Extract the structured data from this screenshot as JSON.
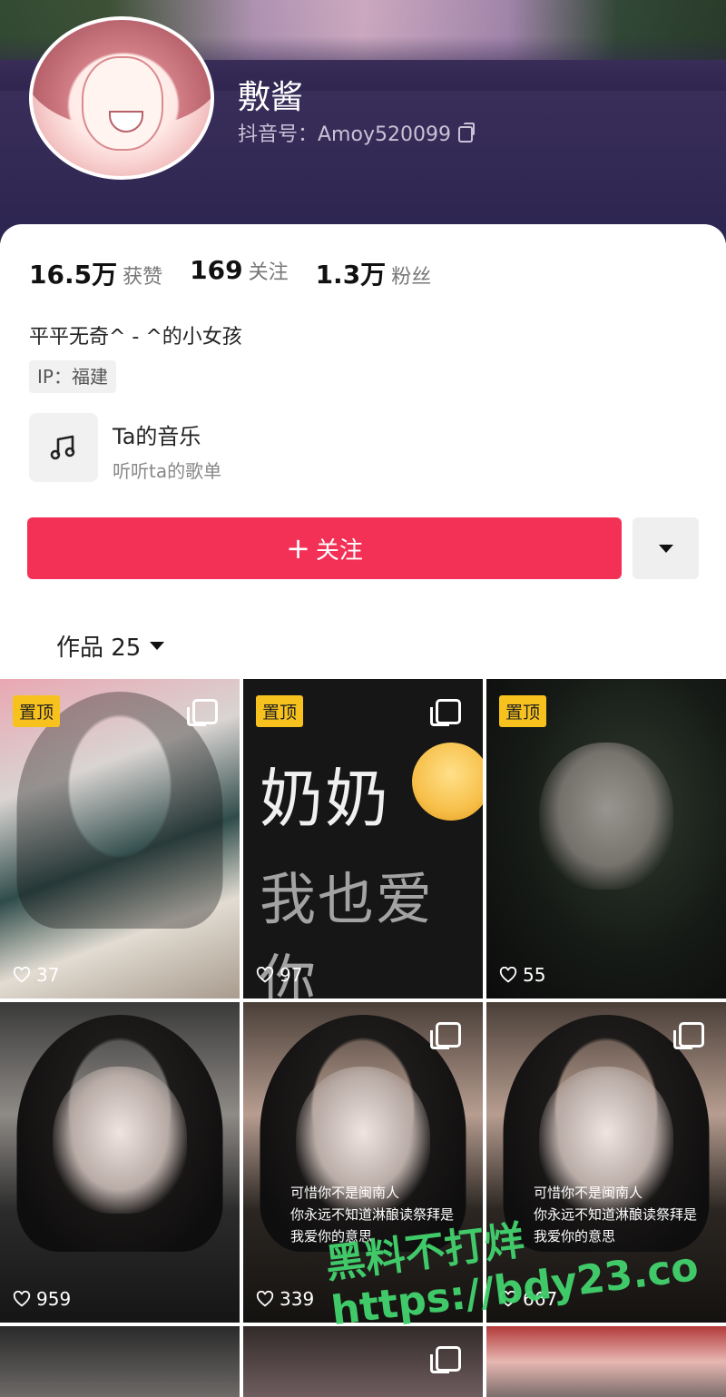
{
  "profile": {
    "name": "敷酱",
    "douyin_id": "抖音号：Amoy520099",
    "stats": [
      {
        "value": "16.5万",
        "label": "获赞"
      },
      {
        "value": "169",
        "label": "关注"
      },
      {
        "value": "1.3万",
        "label": "粉丝"
      }
    ],
    "bio": "平平无奇^ - ^的小女孩",
    "ip": "IP：福建",
    "music": {
      "title": "Ta的音乐",
      "subtitle": "听听ta的歌单"
    },
    "follow_label": "关注",
    "works_tab": "作品 25"
  },
  "videos": [
    {
      "pinned": "置顶",
      "likes": "37",
      "multi": true
    },
    {
      "pinned": "置顶",
      "likes": "97",
      "multi": true,
      "text_line1": "奶奶",
      "text_line2": "我也爱你"
    },
    {
      "pinned": "置顶",
      "likes": "55",
      "multi": false
    },
    {
      "likes": "959",
      "multi": false
    },
    {
      "likes": "339",
      "multi": true,
      "caption": [
        "可惜你不是闽南人",
        "你永远不知道淋酿读祭拜是",
        "我爱你的意思"
      ]
    },
    {
      "likes": "667",
      "multi": true,
      "caption": [
        "可惜你不是闽南人",
        "你永远不知道淋酿读祭拜是",
        "我爱你的意思"
      ]
    },
    {
      "multi": false
    },
    {
      "multi": true
    },
    {
      "multi": false
    }
  ],
  "watermark": {
    "line1": "黑料不打烊",
    "line2": "https://bdy23.co"
  }
}
